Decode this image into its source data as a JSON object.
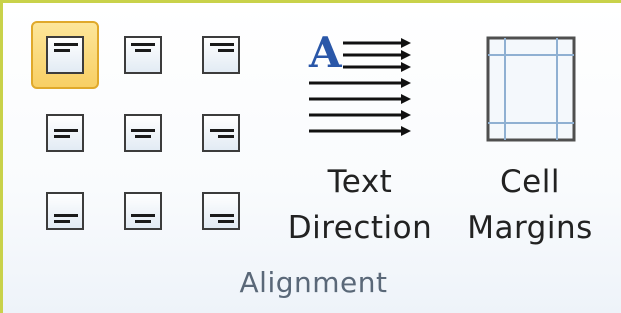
{
  "group": {
    "label": "Alignment"
  },
  "alignment_buttons": [
    {
      "row": "top",
      "align": "left",
      "selected": true,
      "icon": "align-top-left-icon"
    },
    {
      "row": "top",
      "align": "center",
      "selected": false,
      "icon": "align-top-center-icon"
    },
    {
      "row": "top",
      "align": "right",
      "selected": false,
      "icon": "align-top-right-icon"
    },
    {
      "row": "middle",
      "align": "left",
      "selected": false,
      "icon": "align-center-left-icon"
    },
    {
      "row": "middle",
      "align": "center",
      "selected": false,
      "icon": "align-center-icon"
    },
    {
      "row": "middle",
      "align": "right",
      "selected": false,
      "icon": "align-center-right-icon"
    },
    {
      "row": "bottom",
      "align": "left",
      "selected": false,
      "icon": "align-bottom-left-icon"
    },
    {
      "row": "bottom",
      "align": "center",
      "selected": false,
      "icon": "align-bottom-center-icon"
    },
    {
      "row": "bottom",
      "align": "right",
      "selected": false,
      "icon": "align-bottom-right-icon"
    }
  ],
  "text_direction": {
    "label_line1": "Text",
    "label_line2": "Direction",
    "icon": "text-direction-icon",
    "icon_letter": "A"
  },
  "cell_margins": {
    "label_line1": "Cell",
    "label_line2": "Margins",
    "icon": "cell-margins-icon"
  },
  "colors": {
    "selected_fill": "#f8cf64",
    "selected_border": "#e0a92b",
    "group_border": "#c9d24a",
    "label_text": "#5a6878",
    "letter_blue": "#2a57a8"
  }
}
